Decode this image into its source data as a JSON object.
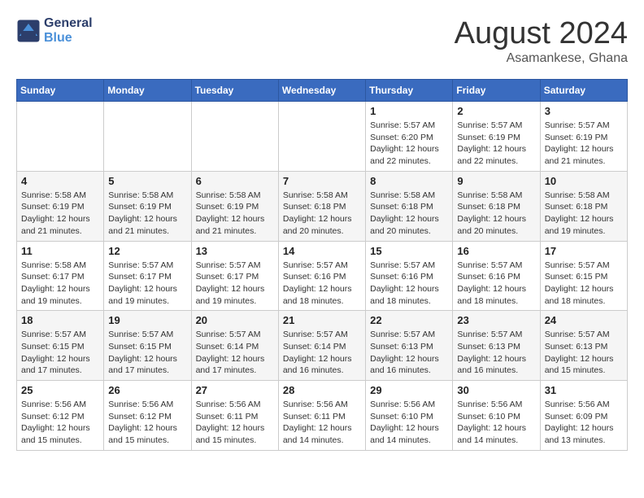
{
  "header": {
    "logo_line1": "General",
    "logo_line2": "Blue",
    "month_year": "August 2024",
    "location": "Asamankese, Ghana"
  },
  "weekdays": [
    "Sunday",
    "Monday",
    "Tuesday",
    "Wednesday",
    "Thursday",
    "Friday",
    "Saturday"
  ],
  "weeks": [
    [
      {
        "day": "",
        "info": ""
      },
      {
        "day": "",
        "info": ""
      },
      {
        "day": "",
        "info": ""
      },
      {
        "day": "",
        "info": ""
      },
      {
        "day": "1",
        "info": "Sunrise: 5:57 AM\nSunset: 6:20 PM\nDaylight: 12 hours\nand 22 minutes."
      },
      {
        "day": "2",
        "info": "Sunrise: 5:57 AM\nSunset: 6:19 PM\nDaylight: 12 hours\nand 22 minutes."
      },
      {
        "day": "3",
        "info": "Sunrise: 5:57 AM\nSunset: 6:19 PM\nDaylight: 12 hours\nand 21 minutes."
      }
    ],
    [
      {
        "day": "4",
        "info": "Sunrise: 5:58 AM\nSunset: 6:19 PM\nDaylight: 12 hours\nand 21 minutes."
      },
      {
        "day": "5",
        "info": "Sunrise: 5:58 AM\nSunset: 6:19 PM\nDaylight: 12 hours\nand 21 minutes."
      },
      {
        "day": "6",
        "info": "Sunrise: 5:58 AM\nSunset: 6:19 PM\nDaylight: 12 hours\nand 21 minutes."
      },
      {
        "day": "7",
        "info": "Sunrise: 5:58 AM\nSunset: 6:18 PM\nDaylight: 12 hours\nand 20 minutes."
      },
      {
        "day": "8",
        "info": "Sunrise: 5:58 AM\nSunset: 6:18 PM\nDaylight: 12 hours\nand 20 minutes."
      },
      {
        "day": "9",
        "info": "Sunrise: 5:58 AM\nSunset: 6:18 PM\nDaylight: 12 hours\nand 20 minutes."
      },
      {
        "day": "10",
        "info": "Sunrise: 5:58 AM\nSunset: 6:18 PM\nDaylight: 12 hours\nand 19 minutes."
      }
    ],
    [
      {
        "day": "11",
        "info": "Sunrise: 5:58 AM\nSunset: 6:17 PM\nDaylight: 12 hours\nand 19 minutes."
      },
      {
        "day": "12",
        "info": "Sunrise: 5:57 AM\nSunset: 6:17 PM\nDaylight: 12 hours\nand 19 minutes."
      },
      {
        "day": "13",
        "info": "Sunrise: 5:57 AM\nSunset: 6:17 PM\nDaylight: 12 hours\nand 19 minutes."
      },
      {
        "day": "14",
        "info": "Sunrise: 5:57 AM\nSunset: 6:16 PM\nDaylight: 12 hours\nand 18 minutes."
      },
      {
        "day": "15",
        "info": "Sunrise: 5:57 AM\nSunset: 6:16 PM\nDaylight: 12 hours\nand 18 minutes."
      },
      {
        "day": "16",
        "info": "Sunrise: 5:57 AM\nSunset: 6:16 PM\nDaylight: 12 hours\nand 18 minutes."
      },
      {
        "day": "17",
        "info": "Sunrise: 5:57 AM\nSunset: 6:15 PM\nDaylight: 12 hours\nand 18 minutes."
      }
    ],
    [
      {
        "day": "18",
        "info": "Sunrise: 5:57 AM\nSunset: 6:15 PM\nDaylight: 12 hours\nand 17 minutes."
      },
      {
        "day": "19",
        "info": "Sunrise: 5:57 AM\nSunset: 6:15 PM\nDaylight: 12 hours\nand 17 minutes."
      },
      {
        "day": "20",
        "info": "Sunrise: 5:57 AM\nSunset: 6:14 PM\nDaylight: 12 hours\nand 17 minutes."
      },
      {
        "day": "21",
        "info": "Sunrise: 5:57 AM\nSunset: 6:14 PM\nDaylight: 12 hours\nand 16 minutes."
      },
      {
        "day": "22",
        "info": "Sunrise: 5:57 AM\nSunset: 6:13 PM\nDaylight: 12 hours\nand 16 minutes."
      },
      {
        "day": "23",
        "info": "Sunrise: 5:57 AM\nSunset: 6:13 PM\nDaylight: 12 hours\nand 16 minutes."
      },
      {
        "day": "24",
        "info": "Sunrise: 5:57 AM\nSunset: 6:13 PM\nDaylight: 12 hours\nand 15 minutes."
      }
    ],
    [
      {
        "day": "25",
        "info": "Sunrise: 5:56 AM\nSunset: 6:12 PM\nDaylight: 12 hours\nand 15 minutes."
      },
      {
        "day": "26",
        "info": "Sunrise: 5:56 AM\nSunset: 6:12 PM\nDaylight: 12 hours\nand 15 minutes."
      },
      {
        "day": "27",
        "info": "Sunrise: 5:56 AM\nSunset: 6:11 PM\nDaylight: 12 hours\nand 15 minutes."
      },
      {
        "day": "28",
        "info": "Sunrise: 5:56 AM\nSunset: 6:11 PM\nDaylight: 12 hours\nand 14 minutes."
      },
      {
        "day": "29",
        "info": "Sunrise: 5:56 AM\nSunset: 6:10 PM\nDaylight: 12 hours\nand 14 minutes."
      },
      {
        "day": "30",
        "info": "Sunrise: 5:56 AM\nSunset: 6:10 PM\nDaylight: 12 hours\nand 14 minutes."
      },
      {
        "day": "31",
        "info": "Sunrise: 5:56 AM\nSunset: 6:09 PM\nDaylight: 12 hours\nand 13 minutes."
      }
    ]
  ]
}
